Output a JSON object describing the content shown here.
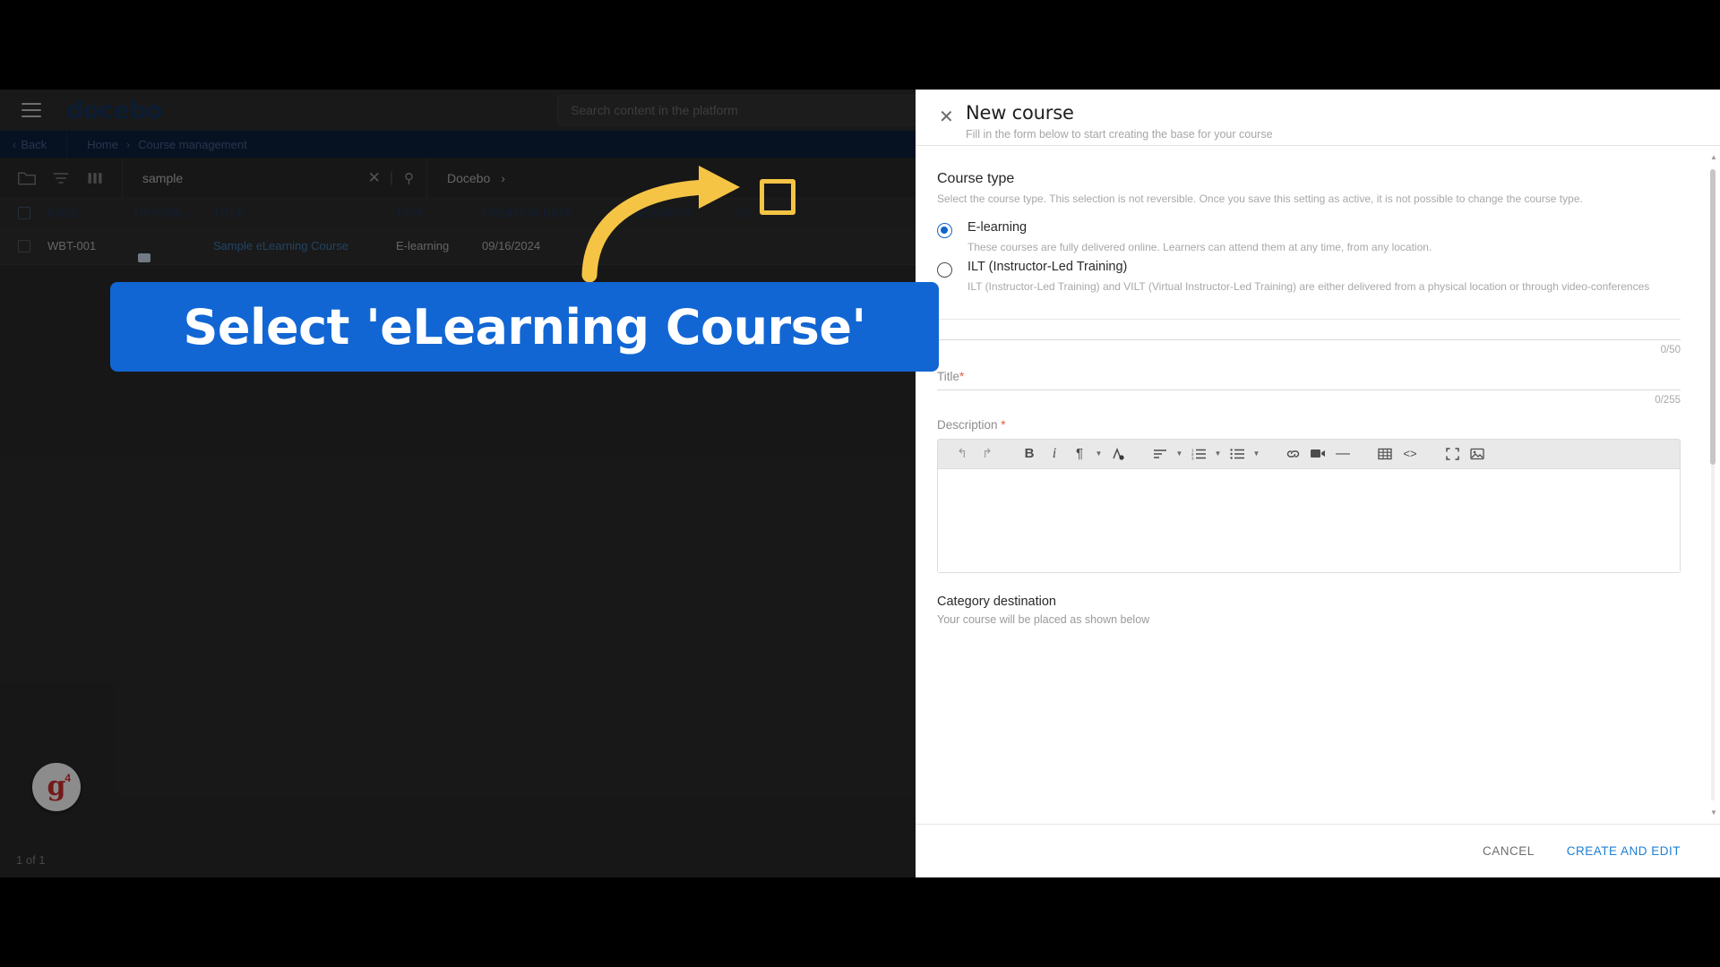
{
  "background_app": {
    "brand": "docebo",
    "brand_mark": "°",
    "menu_icon": "hamburger-icon",
    "search_placeholder": "Search content in the platform",
    "breadcrumb": {
      "back_label": "Back",
      "items": [
        "Home",
        "Course management"
      ],
      "separator": "›"
    },
    "toolbar": {
      "folder_icon": "folder-icon",
      "filter_icon": "filter-icon",
      "columns_icon": "columns-icon",
      "search_value": "sample",
      "clear_label": "✕",
      "search_icon": "search-icon",
      "org_label": "Docebo",
      "org_chevron": "›"
    },
    "table": {
      "columns": [
        "CODE",
        "THUMBN...",
        "TITLE",
        "TYPE",
        "CREATION DATE",
        "SESSIONS",
        "CO"
      ],
      "sort_icon": "sort-icon",
      "rows": [
        {
          "code": "WBT-001",
          "thumbnail": "course-thumbnail",
          "title": "Sample eLearning Course",
          "type": "E-learning",
          "creation_date": "09/16/2024"
        }
      ]
    },
    "footer_count": "1 of 1",
    "logo_badge": {
      "letter": "g",
      "superscript": "4"
    }
  },
  "panel": {
    "close_icon": "close-icon",
    "title": "New course",
    "subtitle": "Fill in the form below to start creating the base for your course",
    "course_type": {
      "heading": "Course type",
      "description": "Select the course type. This selection is not reversible. Once you save this setting as active, it is not possible to change the course type.",
      "options": [
        {
          "label": "E-learning",
          "description": "These courses are fully delivered online. Learners can attend them at any time, from any location.",
          "selected": true
        },
        {
          "label": "ILT (Instructor-Led Training)",
          "description": "ILT (Instructor-Led Training) and VILT (Virtual Instructor-Led Training) are either delivered from a physical location or through video-conferences",
          "selected": false
        }
      ]
    },
    "code_field": {
      "counter": "0/50"
    },
    "title_field": {
      "label": "Title",
      "required": "*",
      "counter": "0/255"
    },
    "description_field": {
      "label": "Description",
      "required": "*",
      "toolbar": [
        {
          "name": "undo-icon",
          "glyph": "↶"
        },
        {
          "name": "redo-icon",
          "glyph": "↷"
        },
        {
          "name": "bold-icon",
          "glyph": "B"
        },
        {
          "name": "italic-icon",
          "glyph": "i"
        },
        {
          "name": "paragraph-icon",
          "glyph": "¶"
        },
        {
          "name": "text-color-icon",
          "glyph": "A"
        },
        {
          "name": "align-icon",
          "glyph": "≡"
        },
        {
          "name": "ordered-list-icon",
          "glyph": "≣"
        },
        {
          "name": "bulleted-list-icon",
          "glyph": "☰"
        },
        {
          "name": "link-icon",
          "glyph": "⚭"
        },
        {
          "name": "video-icon",
          "glyph": "▶"
        },
        {
          "name": "horizontal-rule-icon",
          "glyph": "—"
        },
        {
          "name": "table-icon",
          "glyph": "▦"
        },
        {
          "name": "source-code-icon",
          "glyph": "<>"
        },
        {
          "name": "fullscreen-icon",
          "glyph": "⛶"
        },
        {
          "name": "image-icon",
          "glyph": "Ὓc"
        }
      ]
    },
    "category": {
      "heading": "Category destination",
      "description": "Your course will be placed as shown below"
    },
    "footer": {
      "cancel": "CANCEL",
      "create": "CREATE AND EDIT"
    }
  },
  "annotations": {
    "callout_text": "Select 'eLearning Course'",
    "callout_color": "#1266d3",
    "arrow_color": "#f5c445",
    "highlight_color": "#f5c445"
  }
}
